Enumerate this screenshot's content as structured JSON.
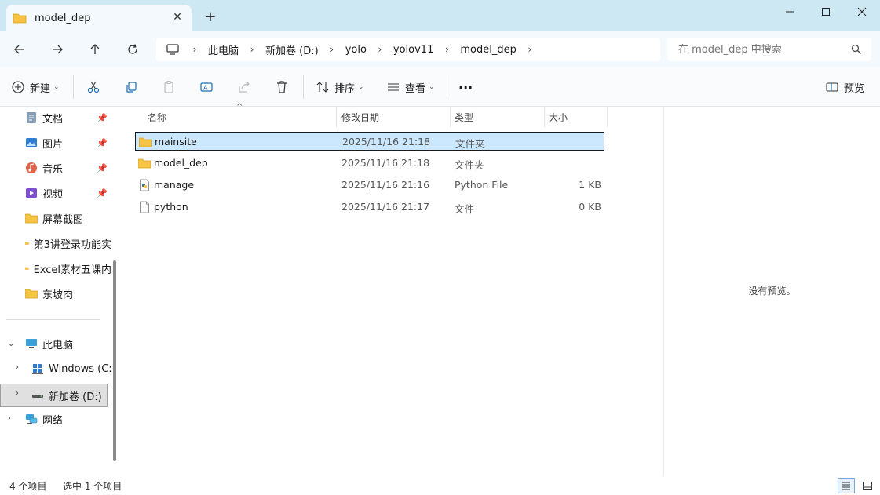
{
  "window": {
    "tab_title": "model_dep",
    "tab_close": "✕",
    "new_tab": "+"
  },
  "address": {
    "breadcrumbs": [
      "此电脑",
      "新加卷 (D:)",
      "yolo",
      "yolov11",
      "model_dep"
    ]
  },
  "search": {
    "placeholder": "在 model_dep 中搜索"
  },
  "toolbar": {
    "new_label": "新建",
    "sort_label": "排序",
    "view_label": "查看",
    "more_label": "···",
    "preview_label": "预览"
  },
  "sidebar": {
    "quick_access": [
      {
        "label": "文档",
        "icon": "document-icon",
        "pinned": true
      },
      {
        "label": "图片",
        "icon": "pictures-icon",
        "pinned": true
      },
      {
        "label": "音乐",
        "icon": "music-icon",
        "pinned": true
      },
      {
        "label": "视频",
        "icon": "video-icon",
        "pinned": true
      },
      {
        "label": "屏幕截图",
        "icon": "folder-icon",
        "pinned": false
      },
      {
        "label": "第3讲登录功能实",
        "icon": "folder-icon",
        "pinned": false
      },
      {
        "label": "Excel素材五课内",
        "icon": "folder-icon",
        "pinned": false
      },
      {
        "label": "东坡肉",
        "icon": "folder-icon",
        "pinned": false
      }
    ],
    "this_pc": "此电脑",
    "drive_c": "Windows (C:)",
    "drive_d": "新加卷 (D:)",
    "network": "网络"
  },
  "columns": {
    "name": "名称",
    "date": "修改日期",
    "type": "类型",
    "size": "大小"
  },
  "files": [
    {
      "name": "mainsite",
      "date": "2025/11/16 21:18",
      "type": "文件夹",
      "size": "",
      "icon": "folder-icon",
      "selected": true
    },
    {
      "name": "model_dep",
      "date": "2025/11/16 21:18",
      "type": "文件夹",
      "size": "",
      "icon": "folder-icon",
      "selected": false
    },
    {
      "name": "manage",
      "date": "2025/11/16 21:16",
      "type": "Python File",
      "size": "1 KB",
      "icon": "python-file-icon",
      "selected": false
    },
    {
      "name": "python",
      "date": "2025/11/16 21:17",
      "type": "文件",
      "size": "0 KB",
      "icon": "file-icon",
      "selected": false
    }
  ],
  "preview": {
    "empty_text": "没有预览。"
  },
  "status": {
    "item_count": "4 个项目",
    "selected_count": "选中 1 个项目"
  },
  "colors": {
    "titlebar": "#cde8f3",
    "selection": "#cce8ff",
    "folder": "#f6c342"
  }
}
